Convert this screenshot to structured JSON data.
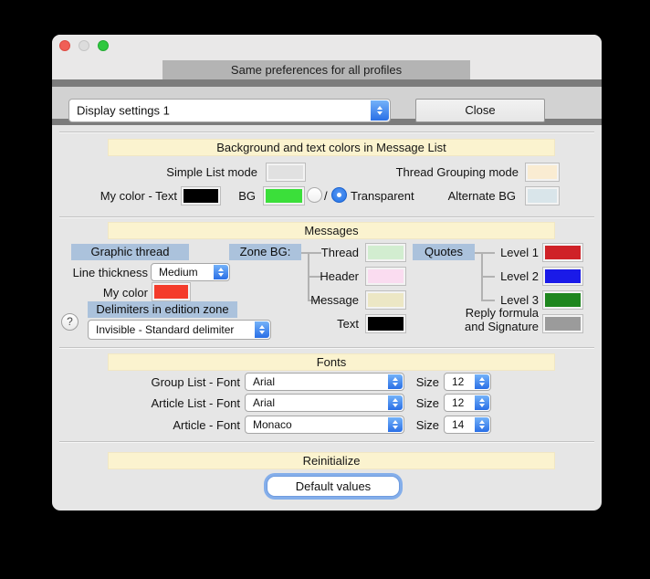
{
  "window": {
    "header_note": "Same preferences for all profiles",
    "profile_select": "Display settings 1",
    "close_label": "Close",
    "help_label": "?"
  },
  "message_list": {
    "title": "Background and text colors in Message List",
    "simple_list_label": "Simple List mode",
    "thread_grouping_label": "Thread Grouping mode",
    "my_color_text_label": "My color - Text",
    "bg_label": "BG",
    "slash": "/",
    "transparent_label": "Transparent",
    "alternate_bg_label": "Alternate BG",
    "colors": {
      "simple_list": "#e1e1e1",
      "thread_grouping": "#faecd2",
      "text": "#000000",
      "bg": "#3bdf3a",
      "alternate_bg": "#d9e5ea"
    }
  },
  "messages": {
    "title": "Messages",
    "graphic_thread_label": "Graphic thread",
    "line_thickness_label": "Line thickness",
    "line_thickness_value": "Medium",
    "my_color_label": "My color",
    "my_color": "#f43b2b",
    "delimiters_label": "Delimiters in edition zone",
    "delimiter_value": "Invisible - Standard delimiter",
    "zone_bg_label": "Zone BG:",
    "zone_items": [
      {
        "label": "Thread",
        "color": "#d2edd0"
      },
      {
        "label": "Header",
        "color": "#fadcf0"
      },
      {
        "label": "Message",
        "color": "#ece7c5"
      },
      {
        "label": "Text",
        "color": "#000000"
      }
    ],
    "quotes_label": "Quotes",
    "quote_items": [
      {
        "label": "Level 1",
        "color": "#cf2127"
      },
      {
        "label": "Level 2",
        "color": "#1a1ae8"
      },
      {
        "label": "Level 3",
        "color": "#1e861e"
      },
      {
        "label": "Reply formula and Signature",
        "color": "#9b9b9b"
      }
    ]
  },
  "fonts": {
    "title": "Fonts",
    "size_label": "Size",
    "rows": [
      {
        "label": "Group List - Font",
        "font": "Arial",
        "size": "12"
      },
      {
        "label": "Article List - Font",
        "font": "Arial",
        "size": "12"
      },
      {
        "label": "Article - Font",
        "font": "Monaco",
        "size": "14"
      }
    ]
  },
  "reinitialize": {
    "title": "Reinitialize",
    "button_label": "Default values"
  }
}
